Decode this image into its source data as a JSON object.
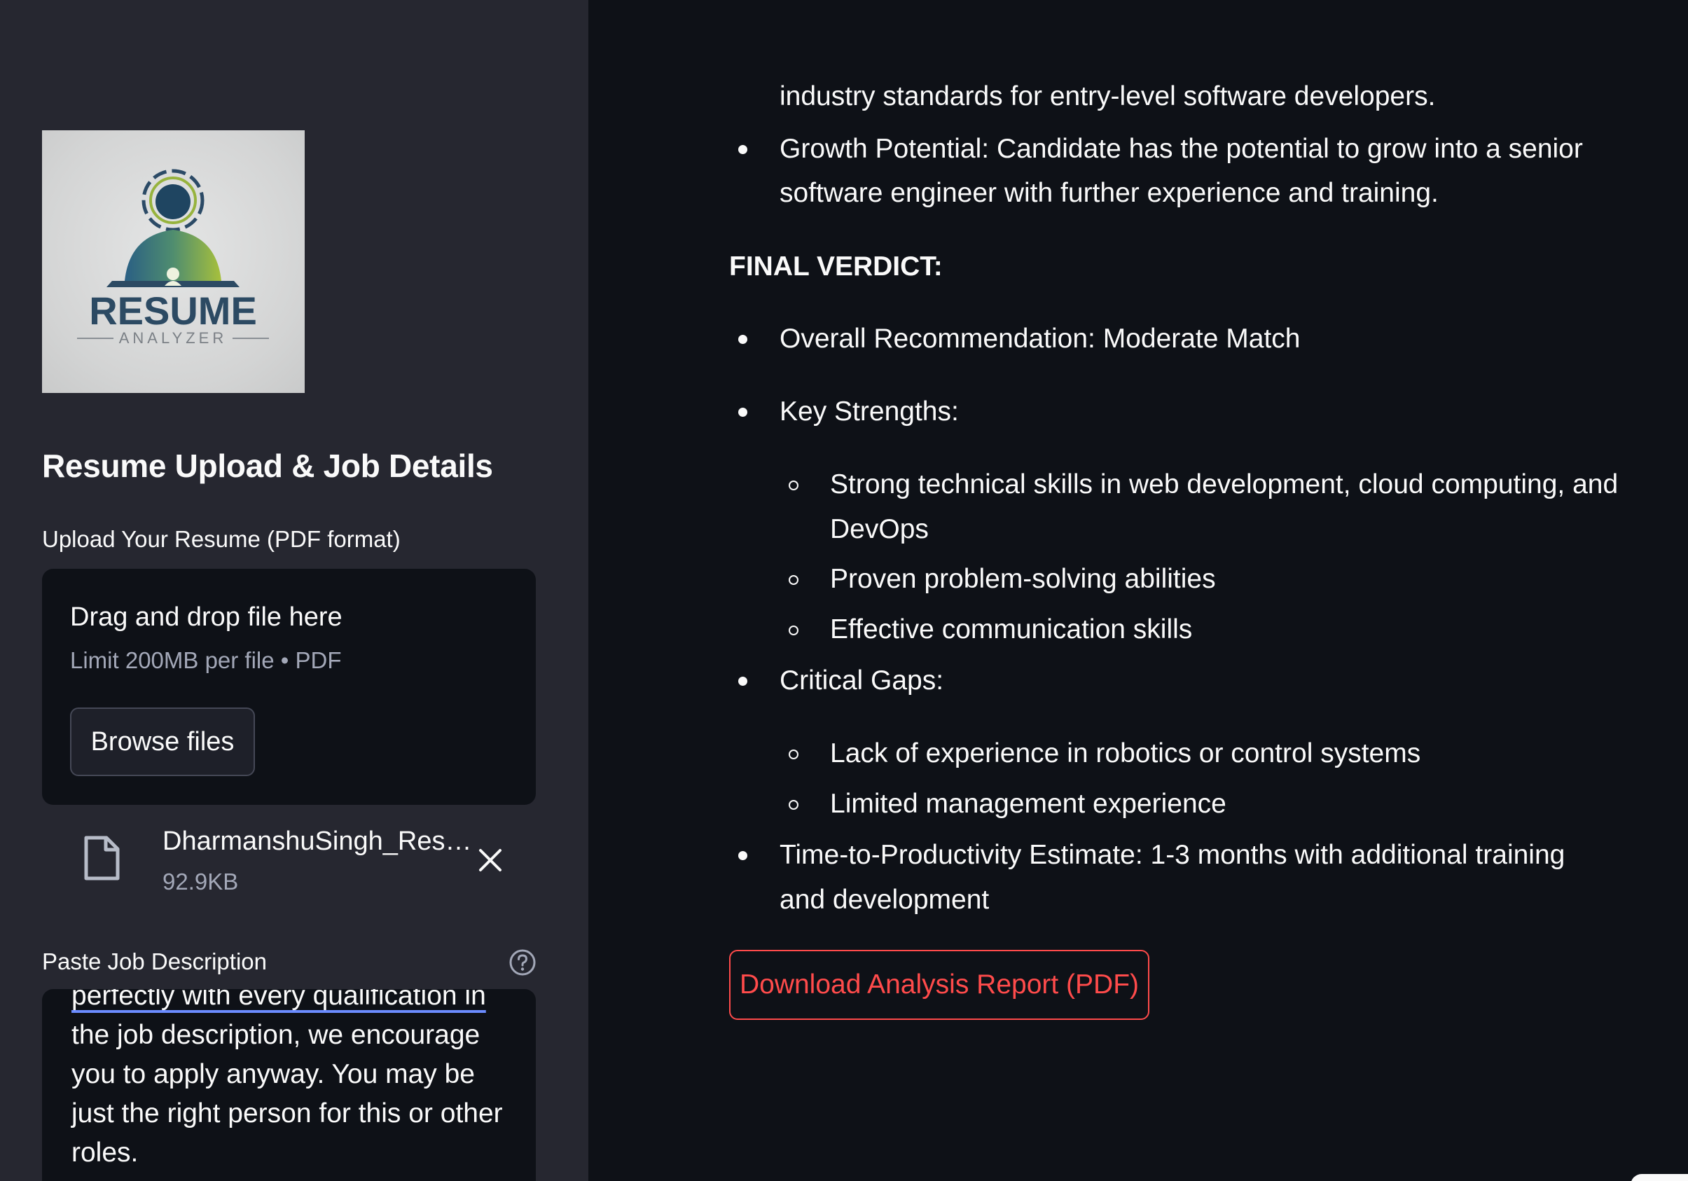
{
  "sidebar": {
    "logo": {
      "title": "RESUME",
      "subtitle": "ANALYZER"
    },
    "title": "Resume Upload & Job Details",
    "upload_label": "Upload Your Resume (PDF format)",
    "dropzone": {
      "title": "Drag and drop file here",
      "limit": "Limit 200MB per file • PDF",
      "browse_label": "Browse files"
    },
    "file": {
      "name": "DharmanshuSingh_Res…",
      "size": "92.9KB"
    },
    "job_description": {
      "label": "Paste Job Description",
      "lines": [
        "perfectly with every qualification in",
        "the job description, we encourage",
        "you to apply anyway. You may be",
        "just the right person for this or other",
        "roles."
      ]
    }
  },
  "main": {
    "partial_line": "industry standards for entry-level software developers.",
    "growth": {
      "line1": "Growth Potential: Candidate has the potential to grow into a senior",
      "line2": "software engineer with further experience and training."
    },
    "verdict_heading": "FINAL VERDICT:",
    "overall": "Overall Recommendation: Moderate Match",
    "strengths": {
      "label": "Key Strengths:",
      "items": [
        {
          "line1": "Strong technical skills in web development, cloud computing, and",
          "line2": "DevOps"
        },
        {
          "line1": "Proven problem-solving abilities"
        },
        {
          "line1": "Effective communication skills"
        }
      ]
    },
    "gaps": {
      "label": "Critical Gaps:",
      "items": [
        "Lack of experience in robotics or control systems",
        "Limited management experience"
      ]
    },
    "time_to_productivity": {
      "line1": "Time-to-Productivity Estimate: 1-3 months with additional training",
      "line2": "and development"
    },
    "download_label": "Download Analysis Report (PDF)"
  },
  "colors": {
    "sidebar_bg": "#262730",
    "main_bg": "#0e1117",
    "accent": "#ff4b4b",
    "muted_text": "#a3a8b8",
    "logo_blue": "#2c4a63",
    "logo_green": "#9bb73a"
  }
}
